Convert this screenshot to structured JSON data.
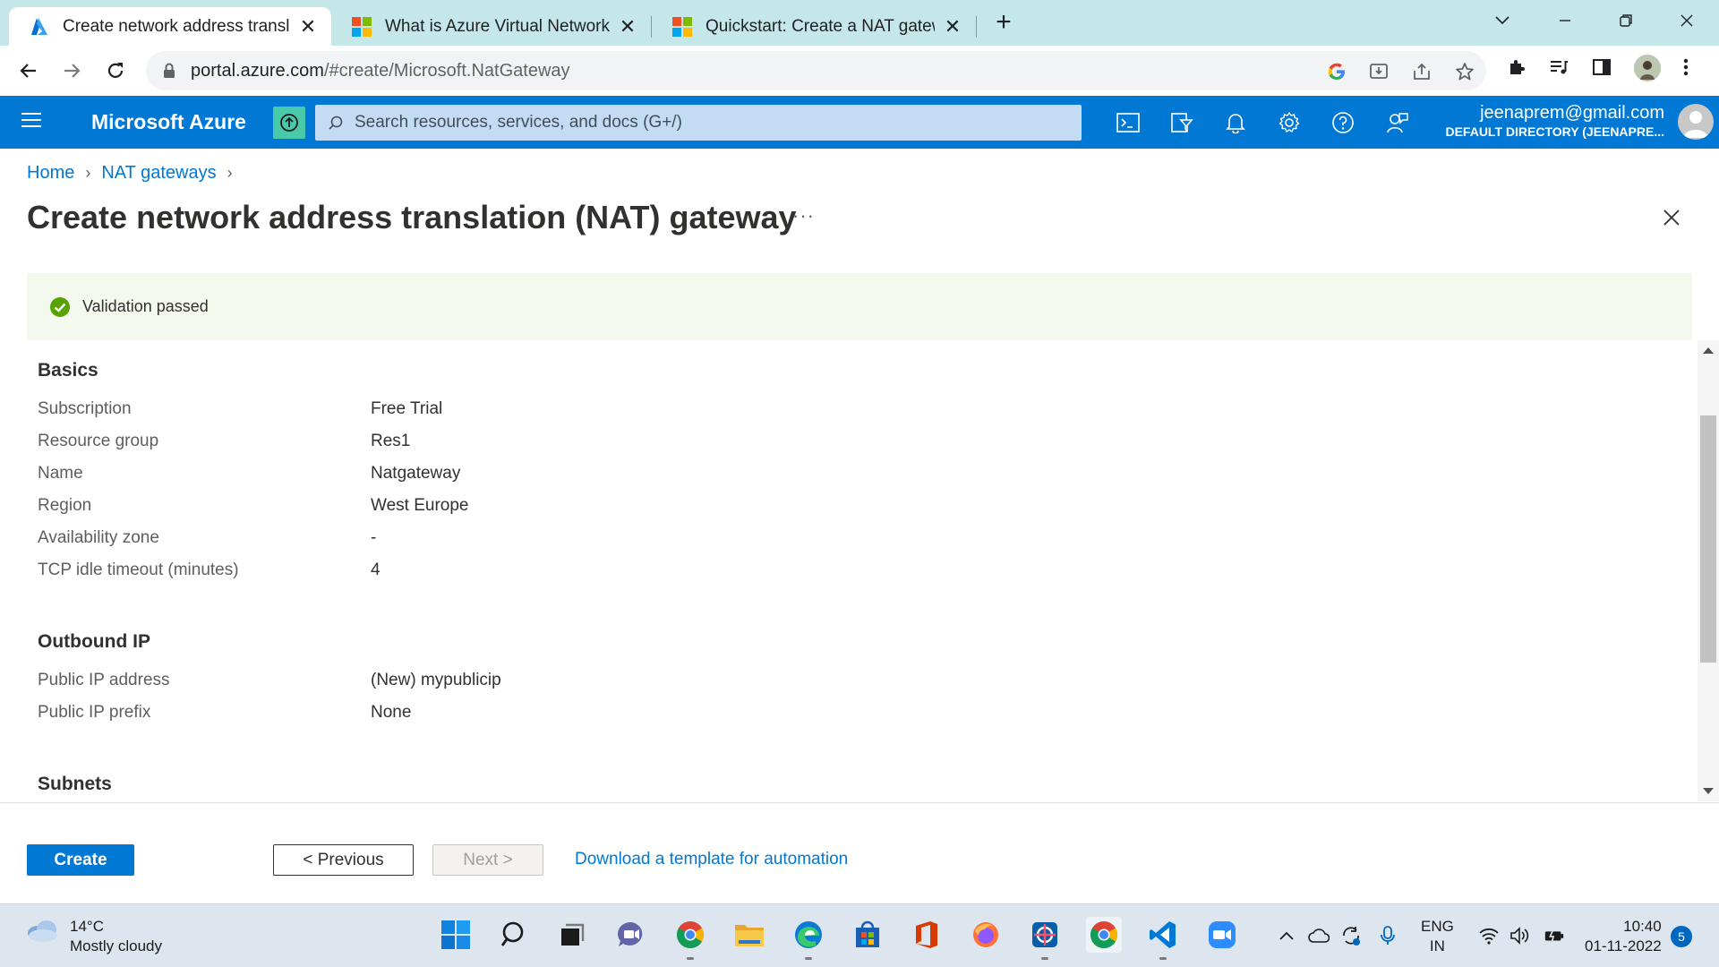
{
  "browser": {
    "tabs": [
      {
        "title": "Create network address translatio",
        "icon": "azure-logo"
      },
      {
        "title": "What is Azure Virtual Network NA",
        "icon": "microsoft-logo"
      },
      {
        "title": "Quickstart: Create a NAT gateway",
        "icon": "microsoft-logo"
      }
    ],
    "url_host": "portal.azure.com",
    "url_path": "/#create/Microsoft.NatGateway"
  },
  "azure_header": {
    "brand": "Microsoft Azure",
    "search_placeholder": "Search resources, services, and docs (G+/)",
    "user_email": "jeenaprem@gmail.com",
    "user_directory": "DEFAULT DIRECTORY (JEENAPRE..."
  },
  "breadcrumb": [
    {
      "label": "Home"
    },
    {
      "label": "NAT gateways"
    }
  ],
  "page": {
    "title": "Create network address translation (NAT) gateway",
    "more": "···"
  },
  "validation": {
    "message": "Validation passed",
    "color": "#57a300"
  },
  "review": {
    "basics": {
      "heading": "Basics",
      "rows": [
        {
          "label": "Subscription",
          "value": "Free Trial"
        },
        {
          "label": "Resource group",
          "value": "Res1"
        },
        {
          "label": "Name",
          "value": "Natgateway"
        },
        {
          "label": "Region",
          "value": "West Europe"
        },
        {
          "label": "Availability zone",
          "value": "-"
        },
        {
          "label": "TCP idle timeout (minutes)",
          "value": "4"
        }
      ]
    },
    "outbound_ip": {
      "heading": "Outbound IP",
      "rows": [
        {
          "label": "Public IP address",
          "value": "(New) mypublicip"
        },
        {
          "label": "Public IP prefix",
          "value": "None"
        }
      ]
    },
    "subnets": {
      "heading": "Subnets"
    }
  },
  "footer": {
    "create": "Create",
    "previous": "< Previous",
    "next": "Next >",
    "download": "Download a template for automation"
  },
  "taskbar": {
    "weather_temp": "14°C",
    "weather_desc": "Mostly cloudy",
    "lang_top": "ENG",
    "lang_bottom": "IN",
    "time": "10:40",
    "date": "01-11-2022",
    "notifications": "5"
  },
  "colors": {
    "azure_blue": "#0078d4",
    "tabstrip": "#c5e7ea",
    "validation_bg": "#f3f9ec"
  }
}
